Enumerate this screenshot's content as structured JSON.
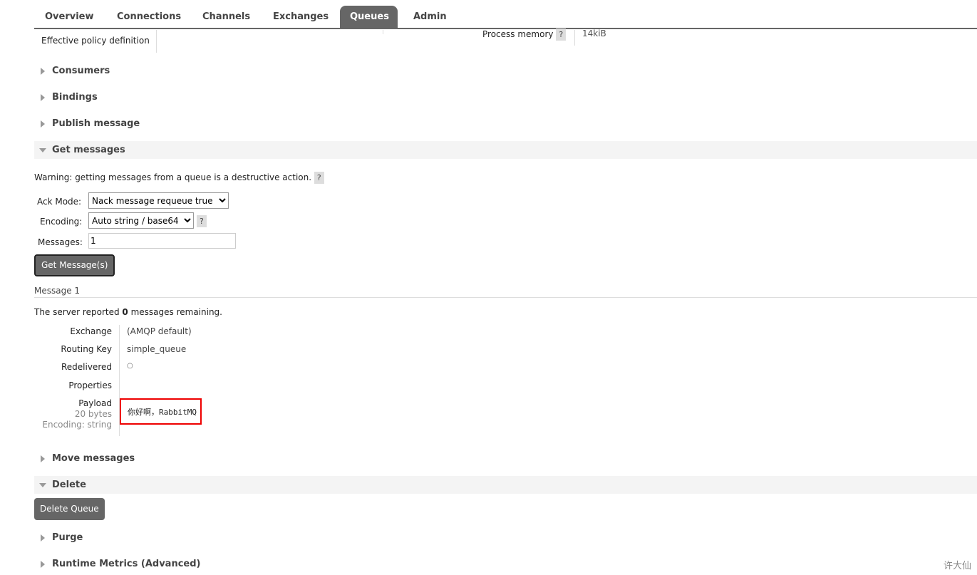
{
  "tabs": [
    "Overview",
    "Connections",
    "Channels",
    "Exchanges",
    "Queues",
    "Admin"
  ],
  "active_tab": "Queues",
  "top": {
    "policy_label": "Effective policy definition",
    "process_memory_label": "Process memory",
    "process_memory_value": "14kiB",
    "help": "?"
  },
  "sections": {
    "consumers": "Consumers",
    "bindings": "Bindings",
    "publish": "Publish message",
    "get": "Get messages",
    "move": "Move messages",
    "delete": "Delete",
    "purge": "Purge",
    "runtime": "Runtime Metrics (Advanced)"
  },
  "get": {
    "warning": "Warning: getting messages from a queue is a destructive action.",
    "ack_label": "Ack Mode:",
    "ack_value": "Nack message requeue true",
    "encoding_label": "Encoding:",
    "encoding_value": "Auto string / base64",
    "messages_label": "Messages:",
    "messages_value": "1",
    "button": "Get Message(s)"
  },
  "message": {
    "title": "Message 1",
    "remaining_pre": "The server reported ",
    "remaining_count": "0",
    "remaining_post": " messages remaining.",
    "exchange_label": "Exchange",
    "exchange": "(AMQP default)",
    "routing_key_label": "Routing Key",
    "routing_key": "simple_queue",
    "redelivered_label": "Redelivered",
    "redelivered": "○",
    "properties_label": "Properties",
    "payload_label": "Payload",
    "payload_size": "20 bytes",
    "payload_encoding": "Encoding: string",
    "payload": "你好啊，RabbitMQ"
  },
  "delete": {
    "button": "Delete Queue"
  },
  "watermark": "许大仙"
}
